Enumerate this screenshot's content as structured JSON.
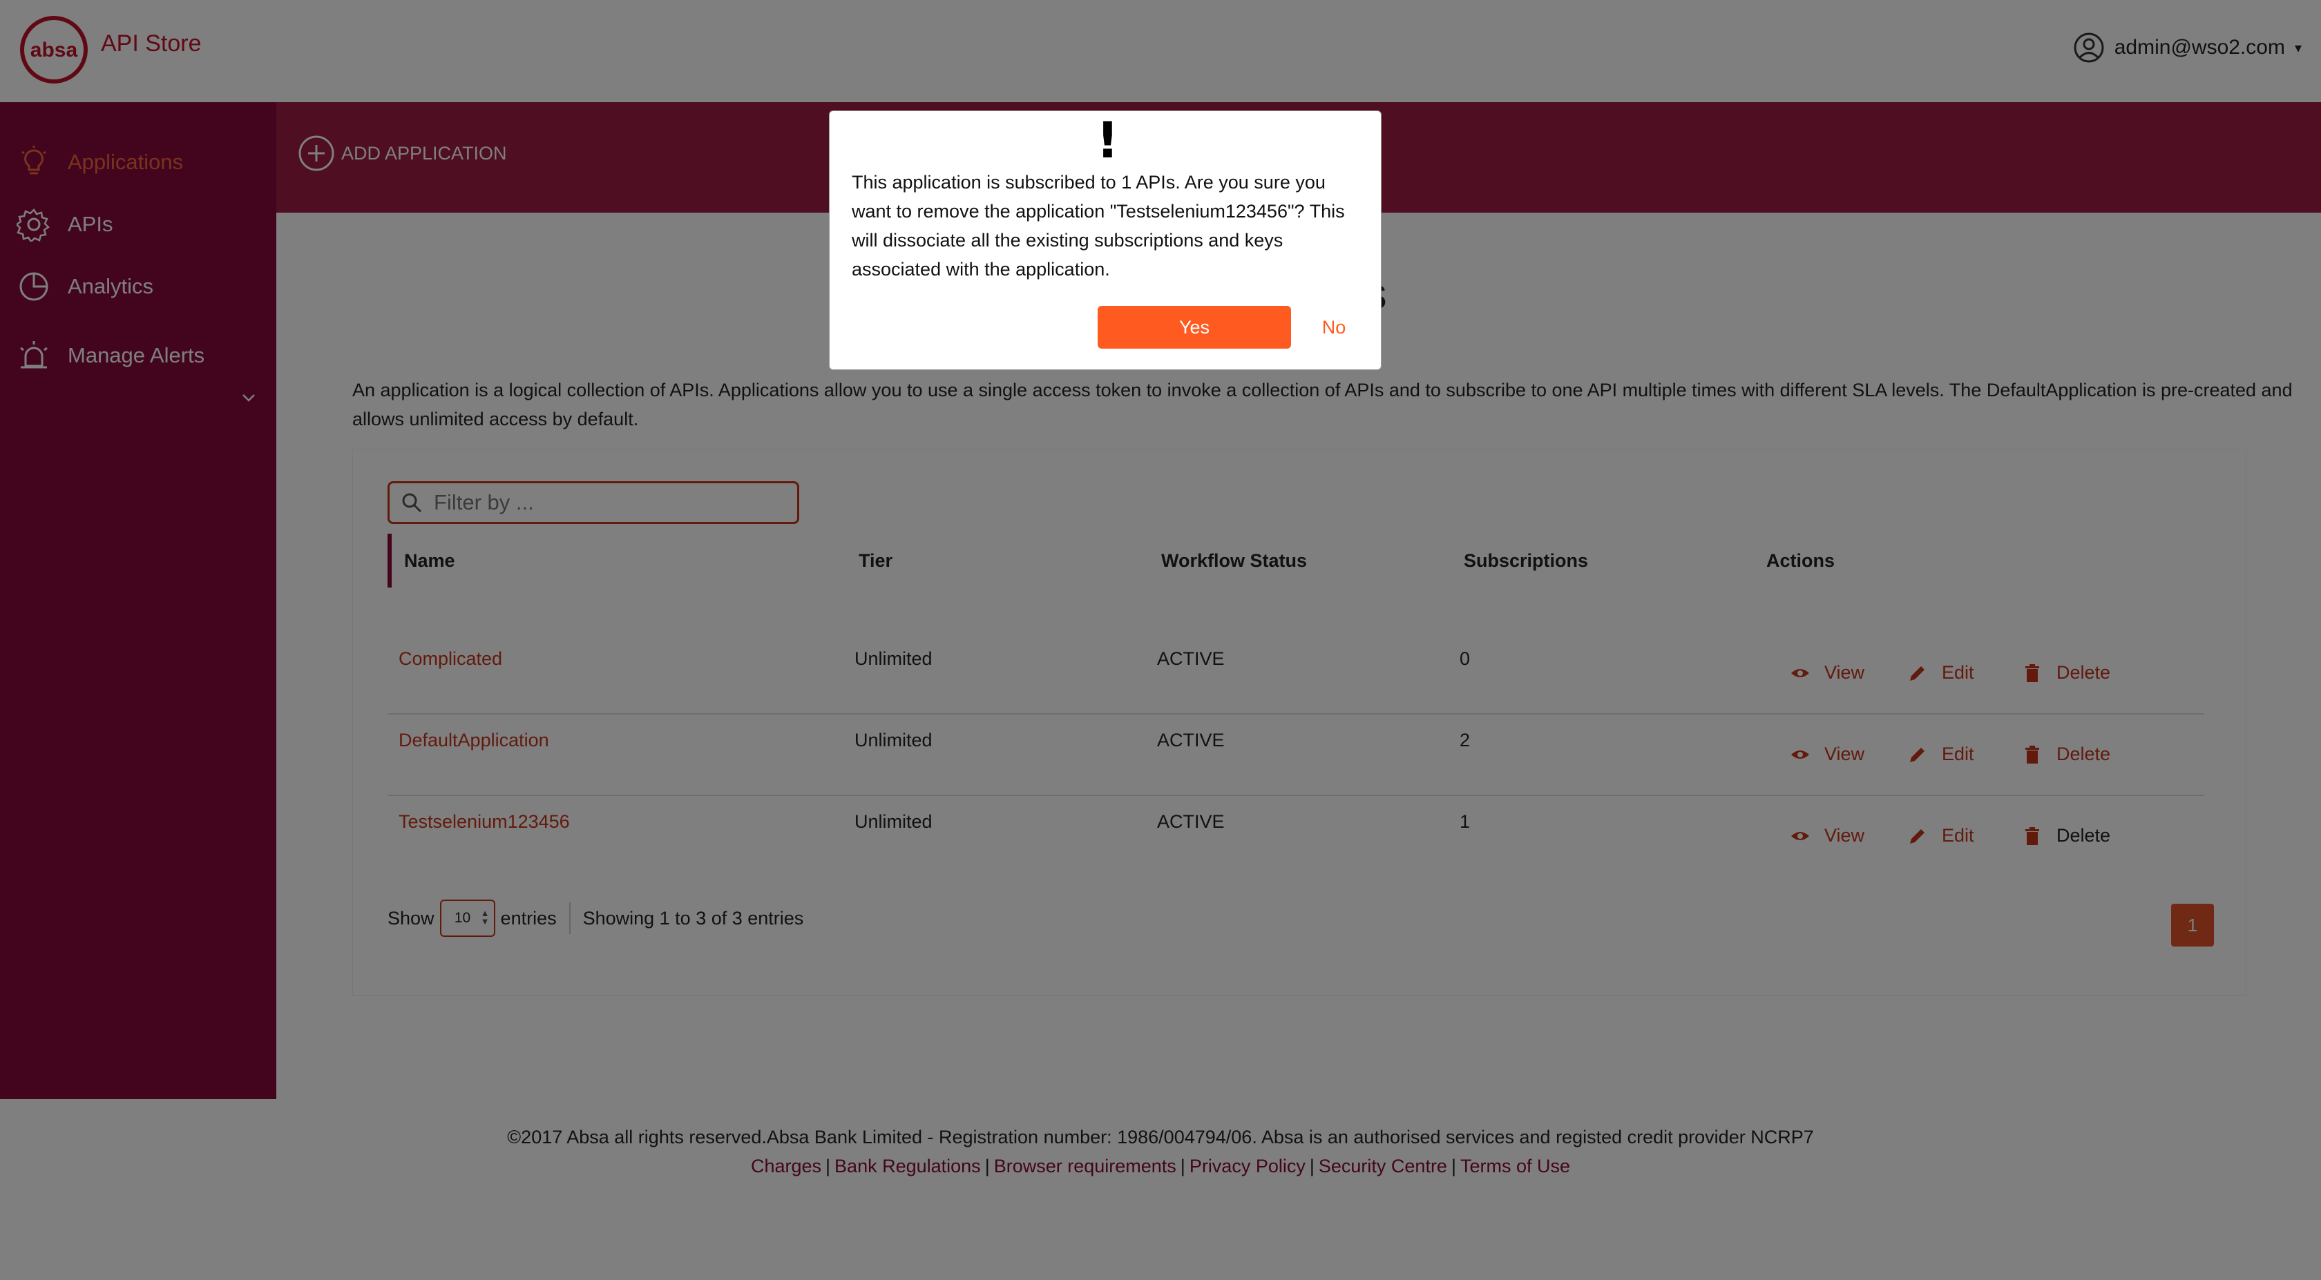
{
  "header": {
    "logo_text": "absa",
    "title": "API Store",
    "user": "admin@wso2.com"
  },
  "sidebar": {
    "items": [
      {
        "label": "Applications",
        "icon": "lightbulb-icon",
        "active": true
      },
      {
        "label": "APIs",
        "icon": "gear-icon"
      },
      {
        "label": "Analytics",
        "icon": "pie-chart-icon"
      },
      {
        "label": "Manage Alerts",
        "icon": "alarm-icon"
      }
    ]
  },
  "banner": {
    "add_application": "ADD APPLICATION"
  },
  "main": {
    "heading_visible_fragment": "ns",
    "description": "An application is a logical collection of APIs. Applications allow you to use a single access token to invoke a collection of APIs and to subscribe to one API multiple times with different SLA levels. The DefaultApplication is pre-created and allows unlimited access by default.",
    "filter_placeholder": "Filter by ...",
    "table": {
      "headers": [
        "Name",
        "Tier",
        "Workflow Status",
        "Subscriptions",
        "Actions"
      ],
      "rows": [
        {
          "name": "Complicated",
          "tier": "Unlimited",
          "status": "ACTIVE",
          "subscriptions": "0"
        },
        {
          "name": "DefaultApplication",
          "tier": "Unlimited",
          "status": "ACTIVE",
          "subscriptions": "2"
        },
        {
          "name": "Testselenium123456",
          "tier": "Unlimited",
          "status": "ACTIVE",
          "subscriptions": "1"
        }
      ],
      "actions": {
        "view": "View",
        "edit": "Edit",
        "delete": "Delete"
      }
    },
    "show_label": "Show",
    "page_size": "10",
    "entries_label": "entries",
    "showing_text": "Showing 1 to 3 of 3 entries",
    "current_page": "1"
  },
  "footer": {
    "copyright": "©2017 Absa all rights reserved.Absa Bank Limited - Registration number: 1986/004794/06. Absa is an authorised services and registed credit provider NCRP7",
    "links": [
      "Charges",
      "Bank Regulations",
      "Browser requirements",
      "Privacy Policy",
      "Security Centre",
      "Terms of Use"
    ]
  },
  "modal": {
    "icon": "!",
    "message": "This application is subscribed to 1 APIs. Are you sure you want to remove the application \"Testselenium123456\"? This will dissociate all the existing subscriptions and keys associated with the application.",
    "yes_label": "Yes",
    "no_label": "No"
  },
  "colors": {
    "brand": "#c0122b",
    "sidebar": "#870a3c",
    "banner": "#9e1c44",
    "accent": "#ff5a1f",
    "link": "#c5351a"
  }
}
